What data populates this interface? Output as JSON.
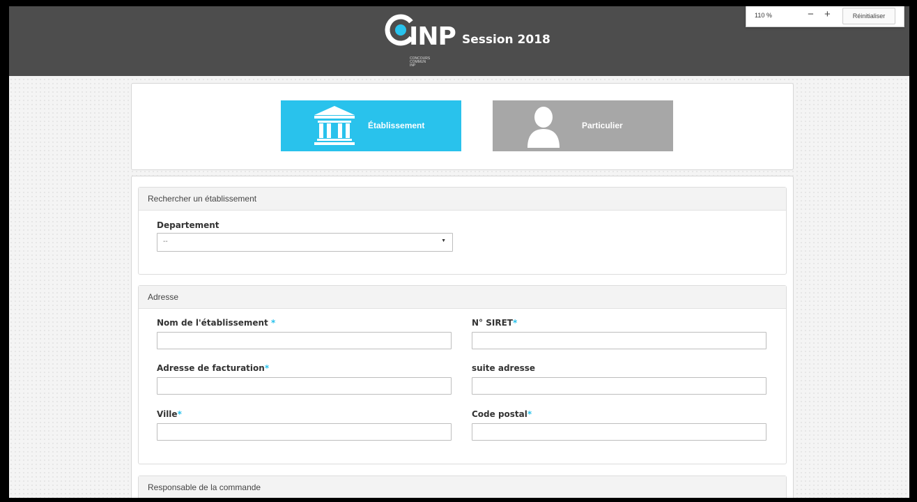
{
  "header": {
    "logo_text": "INP",
    "logo_sub": [
      "CONCOURS",
      "COMMUN",
      "INP"
    ],
    "session": "Session 2018"
  },
  "zoom": {
    "level": "110 %",
    "minus": "−",
    "plus": "+",
    "reset": "Réinitialiser"
  },
  "type_selector": {
    "etablissement": "Établissement",
    "particulier": "Particulier",
    "active_color": "#29c2ec",
    "inactive_color": "#a7a7a7"
  },
  "search": {
    "title": "Rechercher un établissement",
    "departement_label": "Departement",
    "departement_value": "--"
  },
  "adresse": {
    "title": "Adresse",
    "nom_label": "Nom de l'établissement ",
    "siret_label": "N° SIRET",
    "facturation_label": "Adresse de facturation",
    "suite_label": "suite adresse",
    "ville_label": "Ville",
    "cp_label": "Code postal",
    "required_mark": "*"
  },
  "responsable": {
    "title": "Responsable de la commande"
  },
  "colors": {
    "header_bg": "#4d4d4d",
    "accent": "#29c2ec"
  }
}
